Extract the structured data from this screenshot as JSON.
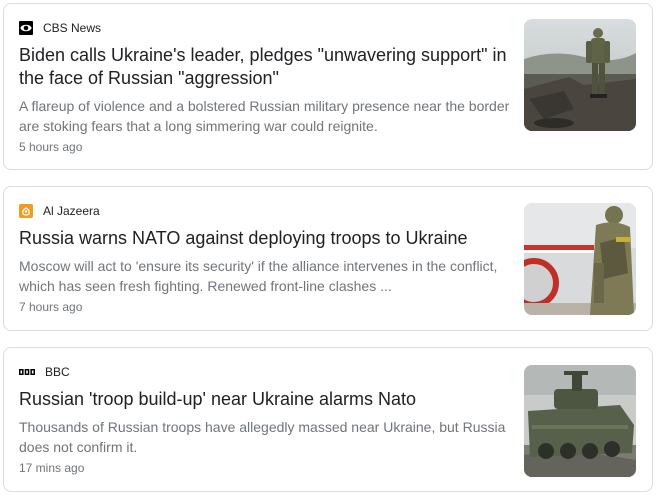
{
  "articles": [
    {
      "source": "CBS News",
      "source_logo": "cbs-eye-logo",
      "headline": "Biden calls Ukraine's leader, pledges \"unwavering support\" in the face of Russian \"aggression\"",
      "snippet": "A flareup of violence and a bolstered Russian military presence near the border are stoking fears that a long simmering war could reignite.",
      "time": "5 hours ago",
      "thumbnail": "soldier-in-trench-photo"
    },
    {
      "source": "Al Jazeera",
      "source_logo": "al-jazeera-logo",
      "headline": "Russia warns NATO against deploying troops to Ukraine",
      "snippet": "Moscow will act to 'ensure its security' if the alliance intervenes in the conflict, which has seen fresh fighting. Renewed front-line clashes ...",
      "time": "7 hours ago",
      "thumbnail": "soldier-at-checkpoint-photo"
    },
    {
      "source": "BBC",
      "source_logo": "bbc-logo",
      "headline": "Russian 'troop build-up' near Ukraine alarms Nato",
      "snippet": "Thousands of Russian troops have allegedly massed near Ukraine, but Russia does not confirm it.",
      "time": "17 mins ago",
      "thumbnail": "armored-vehicle-photo"
    }
  ],
  "colors": {
    "card_border": "#dadce0",
    "headline": "#202124",
    "secondary_text": "#70757a",
    "al_jazeera_orange": "#f29b1d"
  }
}
